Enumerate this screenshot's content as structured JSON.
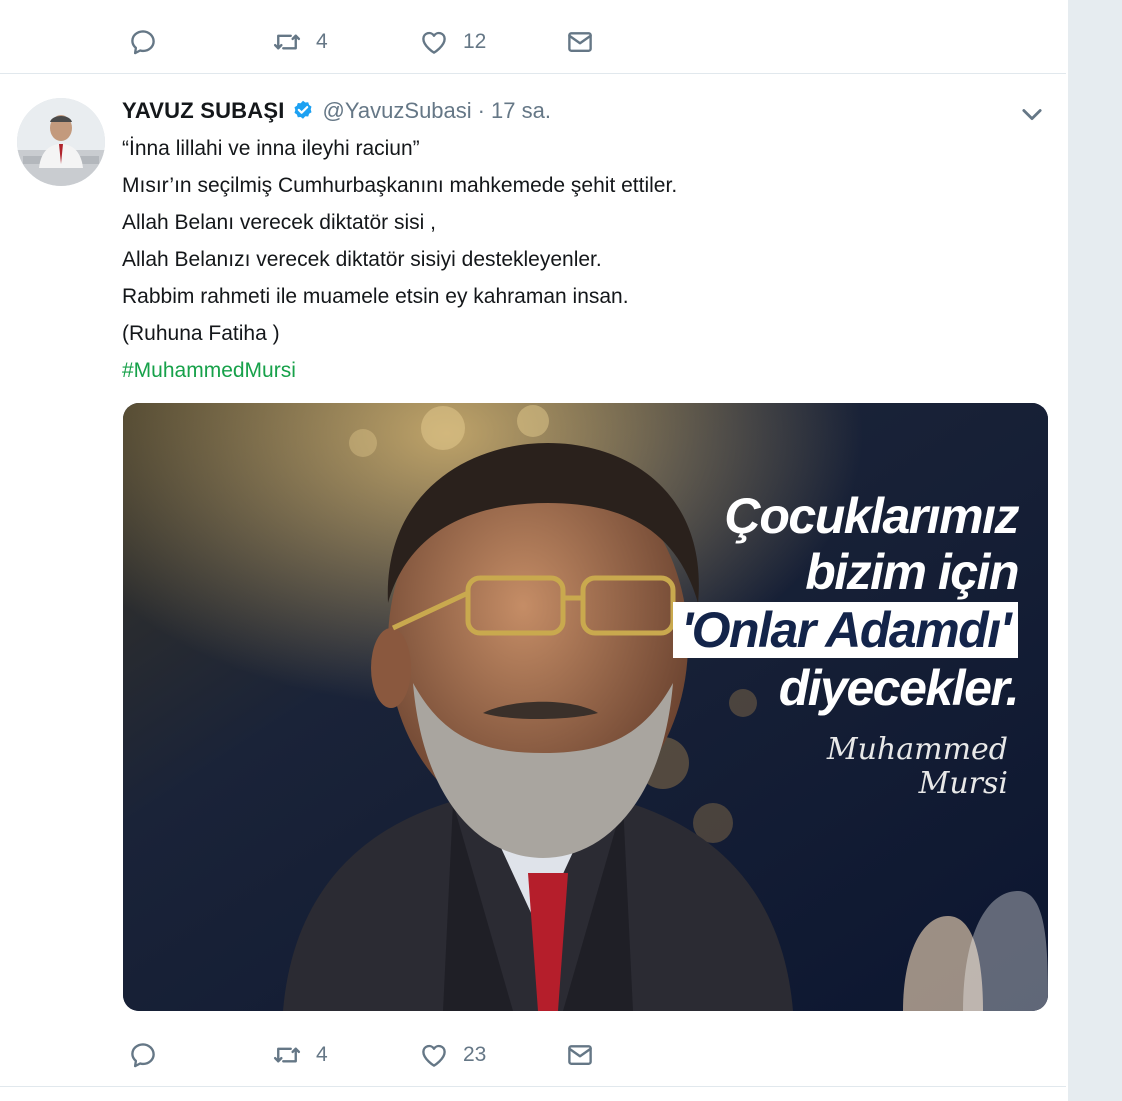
{
  "top_actions": {
    "reply_count": "",
    "retweet_count": "4",
    "like_count": "12"
  },
  "tweet": {
    "author_name": "YAVUZ SUBAŞI",
    "handle": "@YavuzSubasi",
    "separator": "·",
    "time": "17 sa.",
    "lines": [
      "“İnna lillahi ve inna ileyhi raciun”",
      "Mısır’ın seçilmiş Cumhurbaşkanını mahkemede şehit ettiler.",
      "Allah Belanı verecek diktatör sisi ,",
      "Allah Belanızı verecek diktatör sisiyi destekleyenler.",
      "Rabbim rahmeti ile muamele etsin ey kahraman insan.",
      "(Ruhuna Fatiha )"
    ],
    "hashtag": "#MuhammedMursi",
    "image": {
      "quote_lines": [
        "Çocuklarımız",
        "bizim için",
        "'Onlar Adamdı'",
        "diyecekler."
      ],
      "signature_lines": [
        "Muhammed",
        "Mursi"
      ]
    },
    "actions": {
      "retweet_count": "4",
      "like_count": "23"
    }
  },
  "colors": {
    "hashtag": "#17a14a",
    "verified": "#1da1f2",
    "muted": "#657786",
    "image_bg": "#0e1a33"
  },
  "icons": [
    "reply-icon",
    "retweet-icon",
    "like-icon",
    "dm-icon",
    "verified-badge-icon",
    "caret-down-icon"
  ]
}
